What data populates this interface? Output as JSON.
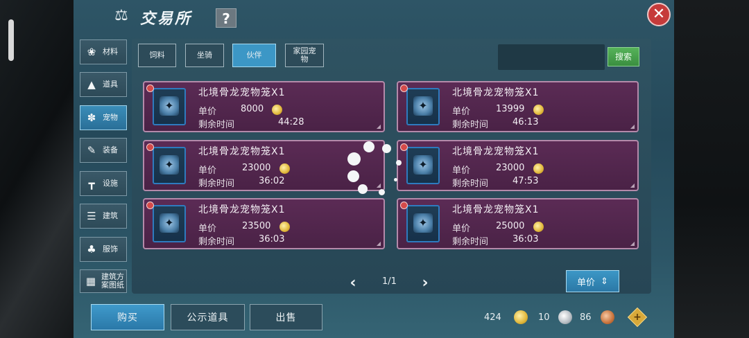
{
  "window": {
    "title": "交易所",
    "help_label": "?",
    "close_label": "✕"
  },
  "sidebar": {
    "items": [
      {
        "label": "材料",
        "icon": "materials-icon"
      },
      {
        "label": "道具",
        "icon": "item-icon"
      },
      {
        "label": "宠物",
        "icon": "paw-icon",
        "active": true
      },
      {
        "label": "装备",
        "icon": "equipment-icon"
      },
      {
        "label": "设施",
        "icon": "facility-icon"
      },
      {
        "label": "建筑",
        "icon": "building-icon"
      },
      {
        "label": "服饰",
        "icon": "clothing-icon"
      },
      {
        "label": "建筑方案图纸",
        "icon": "blueprint-icon"
      }
    ]
  },
  "tabs": [
    {
      "label": "饲料"
    },
    {
      "label": "坐骑"
    },
    {
      "label": "伙伴",
      "active": true
    },
    {
      "label": "家园宠物"
    }
  ],
  "search": {
    "placeholder": "",
    "button_label": "搜索"
  },
  "listings": [
    {
      "name": "北境骨龙宠物笼X1",
      "price_label": "单价",
      "price": "8000",
      "time_label": "剩余时间",
      "time": "44:28"
    },
    {
      "name": "北境骨龙宠物笼X1",
      "price_label": "单价",
      "price": "13999",
      "time_label": "剩余时间",
      "time": "46:13"
    },
    {
      "name": "北境骨龙宠物笼X1",
      "price_label": "单价",
      "price": "23000",
      "time_label": "剩余时间",
      "time": "36:02"
    },
    {
      "name": "北境骨龙宠物笼X1",
      "price_label": "单价",
      "price": "23000",
      "time_label": "剩余时间",
      "time": "47:53"
    },
    {
      "name": "北境骨龙宠物笼X1",
      "price_label": "单价",
      "price": "23500",
      "time_label": "剩余时间",
      "time": "36:03"
    },
    {
      "name": "北境骨龙宠物笼X1",
      "price_label": "单价",
      "price": "25000",
      "time_label": "剩余时间",
      "time": "36:03"
    }
  ],
  "pagination": {
    "text": "1/1",
    "prev": "‹",
    "next": "›"
  },
  "sort": {
    "label": "单价"
  },
  "bottom": {
    "buy_label": "购买",
    "public_label": "公示道具",
    "sell_label": "出售"
  },
  "currency": {
    "gold": "424",
    "silver": "10",
    "bronze": "86"
  },
  "colors": {
    "card_bg": "#5b2b55",
    "accent_blue": "#3c97c6",
    "search_green": "#4aa34f"
  }
}
